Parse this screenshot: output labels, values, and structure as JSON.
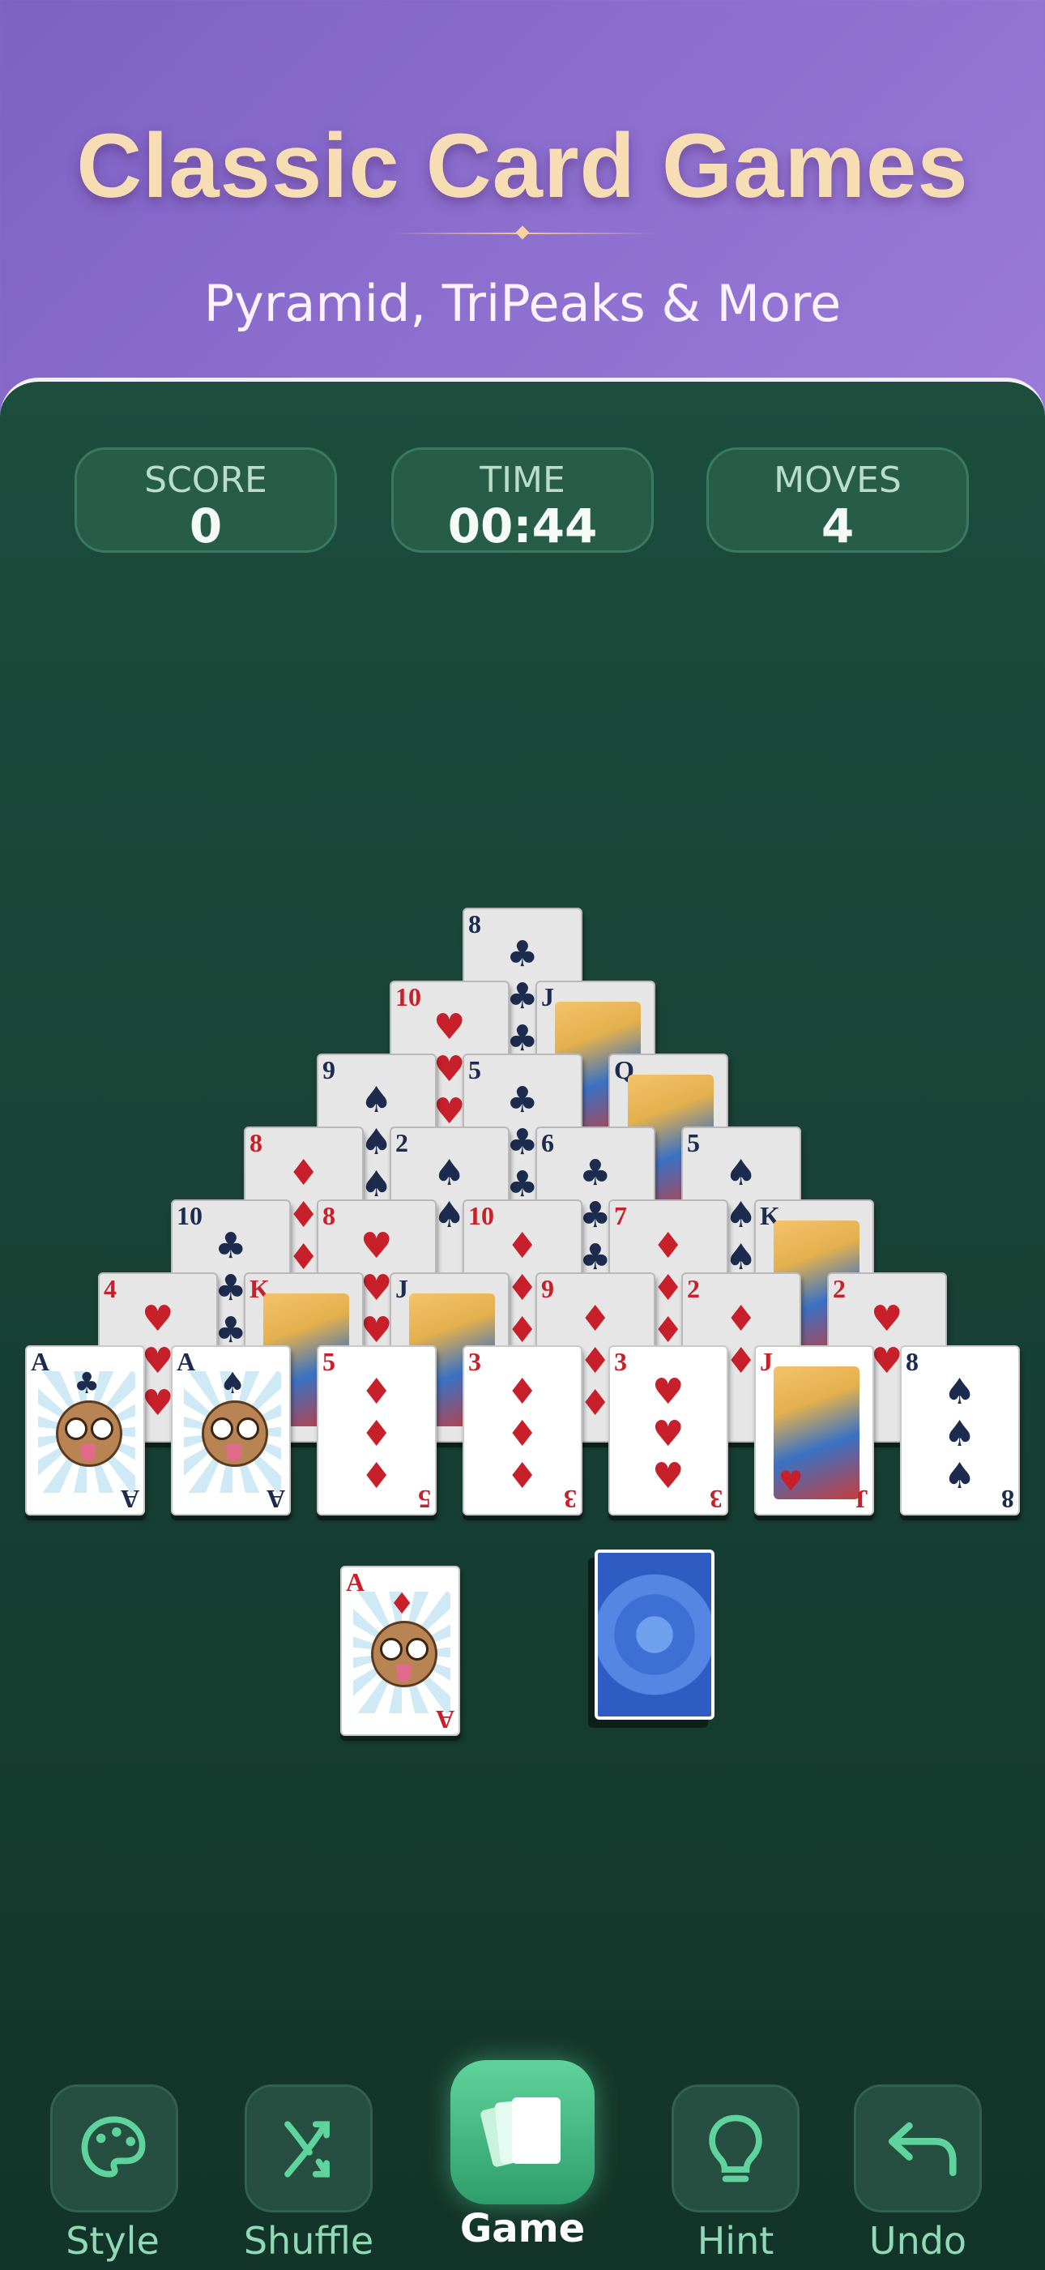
{
  "hero": {
    "title": "Classic Card Games",
    "subtitle": "Pyramid, TriPeaks & More"
  },
  "stats": [
    {
      "label": "SCORE",
      "value": "0"
    },
    {
      "label": "TIME",
      "value": "00:44"
    },
    {
      "label": "MOVES",
      "value": "4"
    }
  ],
  "pyramid": [
    {
      "rank": "8",
      "suit": "♣",
      "color": "black",
      "face": false,
      "dim": true
    },
    {
      "rank": "10",
      "suit": "♥",
      "color": "red",
      "face": false,
      "dim": true
    },
    {
      "rank": "J",
      "suit": "♣",
      "color": "black",
      "face": true,
      "dim": true
    },
    {
      "rank": "9",
      "suit": "♠",
      "color": "black",
      "face": false,
      "dim": true
    },
    {
      "rank": "5",
      "suit": "♣",
      "color": "black",
      "face": false,
      "dim": true
    },
    {
      "rank": "Q",
      "suit": "♠",
      "color": "black",
      "face": true,
      "dim": true
    },
    {
      "rank": "8",
      "suit": "♦",
      "color": "red",
      "face": false,
      "dim": true
    },
    {
      "rank": "2",
      "suit": "♠",
      "color": "black",
      "face": false,
      "dim": true
    },
    {
      "rank": "6",
      "suit": "♣",
      "color": "black",
      "face": false,
      "dim": true
    },
    {
      "rank": "5",
      "suit": "♠",
      "color": "black",
      "face": false,
      "dim": true
    },
    {
      "rank": "10",
      "suit": "♣",
      "color": "black",
      "face": false,
      "dim": true
    },
    {
      "rank": "8",
      "suit": "♥",
      "color": "red",
      "face": false,
      "dim": true
    },
    {
      "rank": "10",
      "suit": "♦",
      "color": "red",
      "face": false,
      "dim": true
    },
    {
      "rank": "7",
      "suit": "♦",
      "color": "red",
      "face": false,
      "dim": true
    },
    {
      "rank": "K",
      "suit": "♣",
      "color": "black",
      "face": true,
      "dim": true
    },
    {
      "rank": "4",
      "suit": "♥",
      "color": "red",
      "face": false,
      "dim": true
    },
    {
      "rank": "K",
      "suit": "♥",
      "color": "red",
      "face": true,
      "dim": true
    },
    {
      "rank": "J",
      "suit": "♠",
      "color": "black",
      "face": true,
      "dim": true
    },
    {
      "rank": "9",
      "suit": "♦",
      "color": "red",
      "face": false,
      "dim": true
    },
    {
      "rank": "2",
      "suit": "♦",
      "color": "red",
      "face": false,
      "dim": true
    },
    {
      "rank": "2",
      "suit": "♥",
      "color": "red",
      "face": false,
      "dim": true
    },
    {
      "rank": "A",
      "suit": "♣",
      "color": "black",
      "ace": true,
      "dim": false
    },
    {
      "rank": "A",
      "suit": "♠",
      "color": "black",
      "ace": true,
      "dim": false
    },
    {
      "rank": "5",
      "suit": "♦",
      "color": "red",
      "face": false,
      "dim": false
    },
    {
      "rank": "3",
      "suit": "♦",
      "color": "red",
      "face": false,
      "dim": false
    },
    {
      "rank": "3",
      "suit": "♥",
      "color": "red",
      "face": false,
      "dim": false
    },
    {
      "rank": "J",
      "suit": "♥",
      "color": "red",
      "face": true,
      "dim": false
    },
    {
      "rank": "8",
      "suit": "♠",
      "color": "black",
      "face": false,
      "dim": false
    }
  ],
  "waste": {
    "rank": "A",
    "suit": "♦",
    "color": "red"
  },
  "toolbar": [
    {
      "label": "Style",
      "icon": "palette-icon"
    },
    {
      "label": "Shuffle",
      "icon": "shuffle-icon"
    },
    {
      "label": "Game",
      "icon": "cards-icon"
    },
    {
      "label": "Hint",
      "icon": "lightbulb-icon"
    },
    {
      "label": "Undo",
      "icon": "undo-icon"
    }
  ],
  "colors": {
    "felt": "#1c4d3d",
    "accent": "#4fc38b",
    "hero_title": "#f6ddb3"
  }
}
